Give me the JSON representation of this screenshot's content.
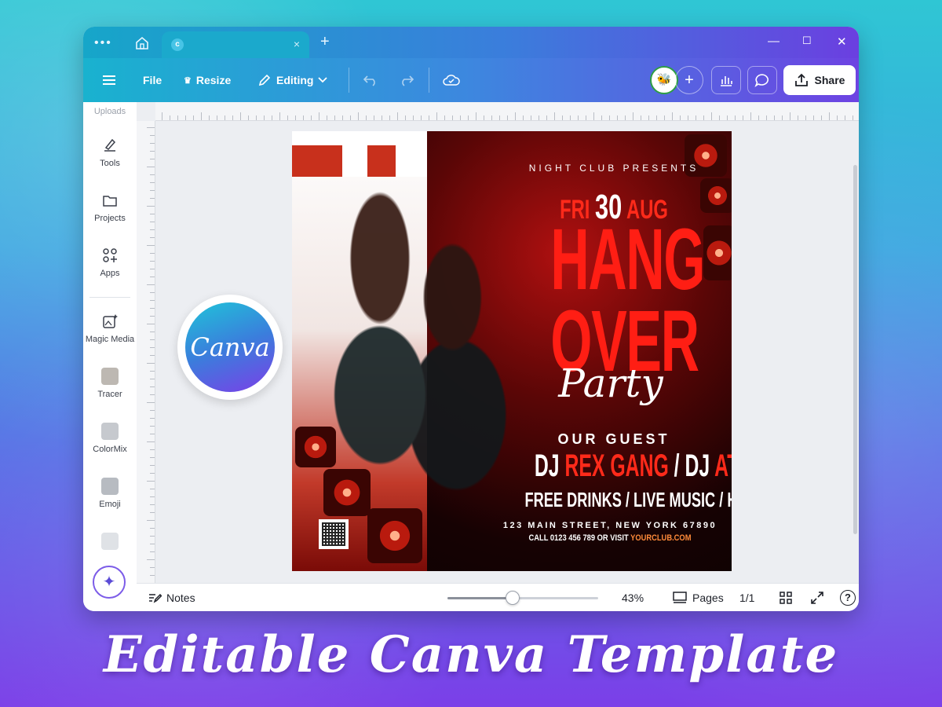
{
  "titlebar": {
    "tab_close": "×",
    "new_tab": "+",
    "minimize": "—",
    "maximize": "☐",
    "close": "✕"
  },
  "toolbar": {
    "file_label": "File",
    "resize_label": "Resize",
    "editing_label": "Editing",
    "share_label": "Share",
    "add_label": "+"
  },
  "sidebar": {
    "items": [
      {
        "label": "Uploads"
      },
      {
        "label": "Tools"
      },
      {
        "label": "Projects"
      },
      {
        "label": "Apps"
      },
      {
        "label": "Magic Media"
      },
      {
        "label": "Tracer"
      },
      {
        "label": "ColorMix"
      },
      {
        "label": "Emoji"
      }
    ]
  },
  "flyer": {
    "presents": "NIGHT CLUB PRESENTS",
    "date_day": "FRI",
    "date_num": "30",
    "date_month": "AUG",
    "title_line1": "HANG",
    "title_line2": "OVER",
    "script": "Party",
    "guest_label": "OUR GUEST",
    "dj1_prefix": "DJ",
    "dj1_name": "REX GANG",
    "dj_separator": "/",
    "dj2_prefix": "DJ",
    "dj2_name": "ATOM FIRE",
    "features": "FREE DRINKS / LIVE MUSIC / HOOKAH",
    "address": "123 MAIN STREET, NEW YORK 67890",
    "call_prefix": "CALL 0123 456 789 OR VISIT",
    "url": "YOURCLUB.COM"
  },
  "badge": {
    "text": "Canva"
  },
  "footer": {
    "notes_label": "Notes",
    "zoom": "43%",
    "zoom_fraction": 0.43,
    "pages_label": "Pages",
    "page_count": "1/1",
    "help_label": "?"
  },
  "headline": "Editable Canva Template",
  "colors": {
    "accent": "#3b7ddc",
    "flyer_red": "#ff1e14",
    "url_orange": "#ff8a3a"
  }
}
